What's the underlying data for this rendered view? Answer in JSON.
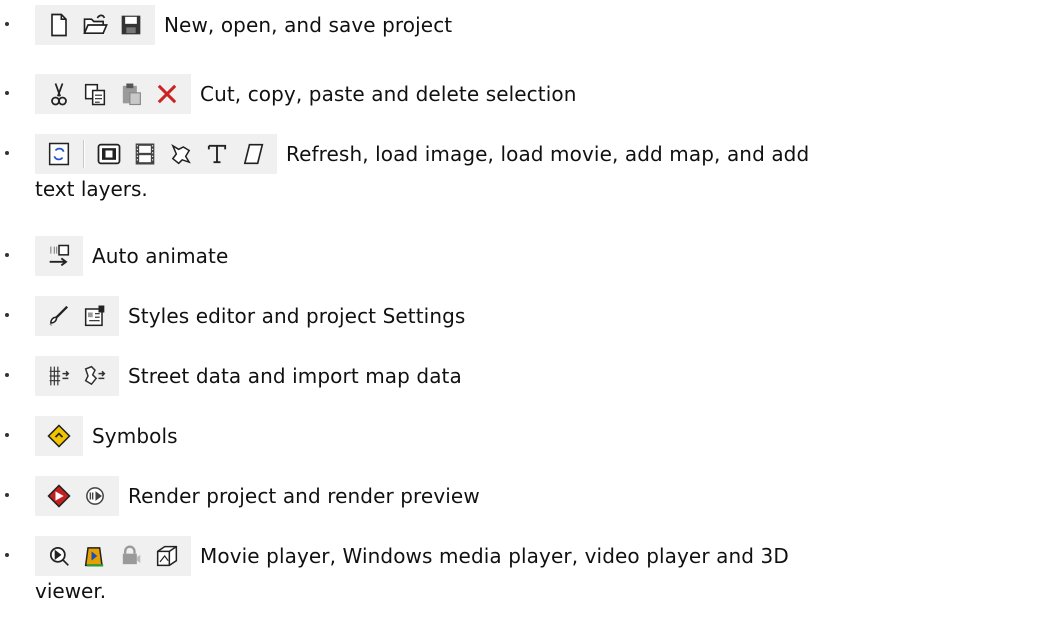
{
  "items": [
    {
      "label": "New, open, and save project",
      "icons": [
        "new-file-icon",
        "open-folder-icon",
        "save-disk-icon"
      ]
    },
    {
      "label": "Cut, copy, paste and delete selection",
      "icons": [
        "scissors-icon",
        "copy-icon",
        "paste-icon",
        "delete-icon"
      ]
    },
    {
      "label": "Refresh, load image, load movie, add map, and add",
      "continuation": "text layers.",
      "icons": [
        "refresh-icon",
        "load-image-icon",
        "film-icon",
        "map-icon",
        "text-tool-icon",
        "shape-icon"
      ]
    },
    {
      "label": "Auto animate",
      "icons": [
        "auto-animate-icon"
      ]
    },
    {
      "label": "Styles editor and project Settings",
      "icons": [
        "paintbrush-icon",
        "settings-icon"
      ]
    },
    {
      "label": "Street data and import map data",
      "icons": [
        "street-data-icon",
        "import-map-icon"
      ]
    },
    {
      "label": "Symbols",
      "icons": [
        "symbol-diamond-icon"
      ]
    },
    {
      "label": "Render project and render preview",
      "icons": [
        "render-icon",
        "render-preview-icon"
      ]
    },
    {
      "label": "Movie player, Windows media player, video player and 3D",
      "continuation": "viewer.",
      "icons": [
        "movie-player-icon",
        "windows-media-player-icon",
        "video-player-icon",
        "3d-viewer-icon"
      ]
    }
  ],
  "colors": {
    "toolbar_bg": "#f0f0f0",
    "delete_red": "#cc2222",
    "symbol_yellow": "#f2c400",
    "render_red": "#c81e1e"
  }
}
